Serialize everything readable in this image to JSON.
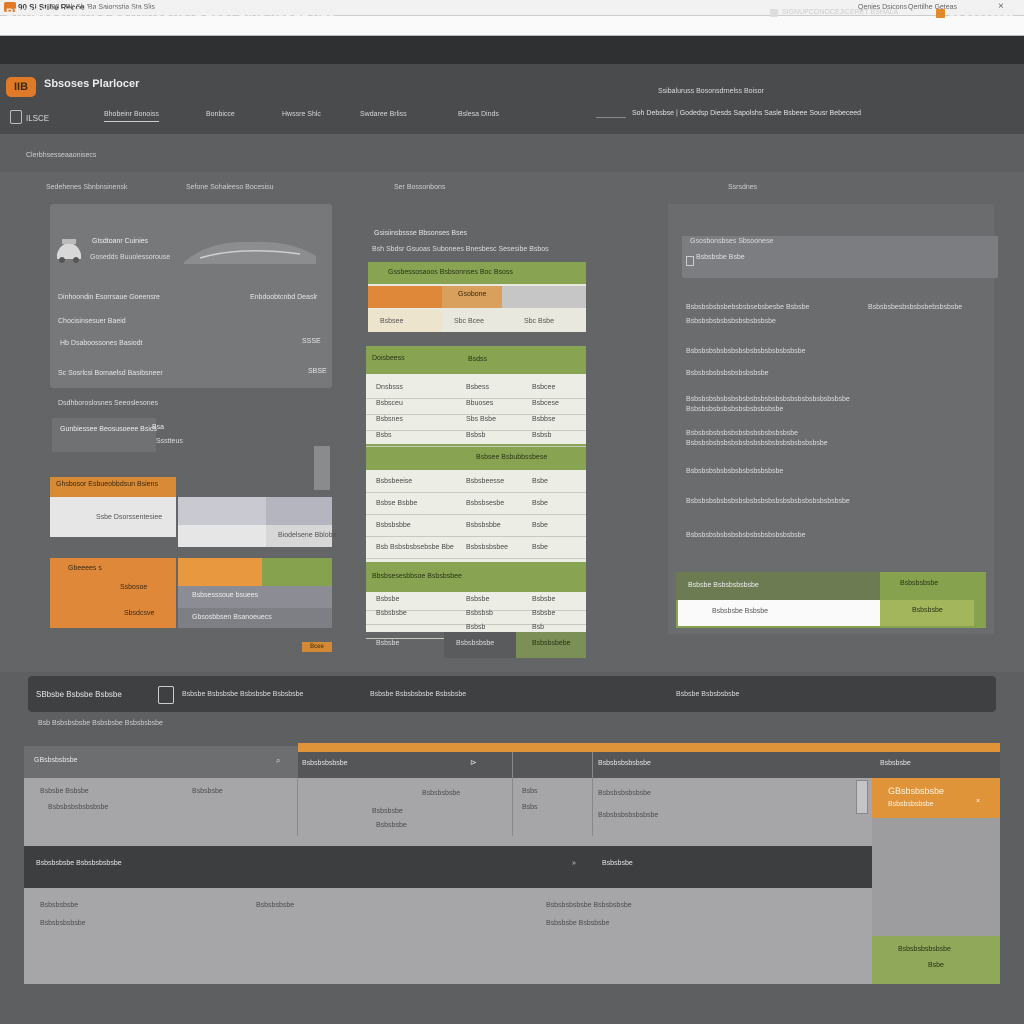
{
  "browser": {
    "tab_title": "90 Si Stibe Recce",
    "tab_url": "Q3 · Rk Sh 'Ba  Saiorsstia Sta Slis",
    "right_1": "Qenies Dsicons",
    "right_2": "Qertilhe Geteas",
    "close": "×"
  },
  "header": {
    "app_title": "BWRESSCRIDRSC BSTRIRODRSTE ESST  BIRS'NSDEE RES",
    "right_text": "SIGNUPCONOCEJICERET BSHALA",
    "user_label": "BS DSCOSSES"
  },
  "subheader": {
    "brand_logo": "IIB",
    "brand_name": "Sbsoses Plarlocer",
    "right_text": "Ssibaluruss Bosonsdrnelss Boisor",
    "back_label": "ILSCE",
    "tabs": [
      "Bhobeinr Bonoiss",
      "Bonbicce",
      "Hwssre Shlc",
      "Swdaree Brliss",
      "Bslesa Dinds"
    ],
    "status": "Soh Debsbse | Godedsp Diesds Sapolshs Sasle Bsbeee Sousr Bebeceed"
  },
  "page": {
    "title": "Clerbhsesseaaonisecs",
    "col_heads": [
      "Sedehenes Sbnbnsinensk",
      "Sefone Sohaleeso Bocesisu",
      "Ser Bossonbons",
      "Ssrsdnes"
    ]
  },
  "left_card": {
    "title": "Gtsdtoanr Cuinies",
    "subtitle": "Gosedds Buuolessorouse",
    "rows": [
      {
        "label": "Dinhoondin Esorrsaue Goeensre",
        "value": "Enbdoobtcnbd Deaslr"
      },
      {
        "label": "Chocisinsesuer Baeid"
      },
      {
        "label": "Hb Dsaboossones Basiodt",
        "value": "SSSE"
      },
      {
        "label": "Sc Sosrlcsi Bomaelsd Basibsneer",
        "value": "SBSE"
      }
    ],
    "note": "Dsdhboroslosnes Seeoslesones",
    "filter_label": "Gunbiessee Beosusoeee Bsics",
    "filter_x": "Bsa",
    "filter_sub": "Ssstteus",
    "orange_header": "Ghsbosor Esbueobbdsun Bsiens",
    "white_cell": "Ssbe Dsorssentesiee",
    "white_cell_2": "Biodelsene Bblobe",
    "orange_block": [
      "Gbeeees s",
      "Ssbosoe",
      "Sbsdcsve"
    ],
    "orange_extra_1": "Bsbsesssoue bsuees",
    "orange_extra_2": "Gbsosbbsen Bsanoeuecs",
    "tag": "Bcee"
  },
  "middle": {
    "title": "Gsisiinsbssse Bbsonses Bses",
    "subtitle": "Bsh Sbdsr Gsuoas Subonees Bnesbesc Sesesibe Bsbos",
    "plan_header": "Gssbessosaoos Bsbsonnses Boc Bsoss",
    "plan_bar_label": "Gsobone",
    "plan_row": [
      "Bsbsee",
      "Sbc Bcee",
      "Sbc Bsbe"
    ],
    "table_head_a": "Doisbeess",
    "table_head_b": "Bsdss",
    "table_rows_1": [
      [
        "Dnsbsss",
        "Bsbess",
        "Bsbcee"
      ],
      [
        "Bsbsceu",
        "Bbuoses",
        "Bsbcese"
      ],
      [
        "Bsbsnes",
        "Sbs Bsbe",
        "Bsbbse"
      ],
      [
        "Bsbs",
        "Bsbsb",
        "Bsbsb"
      ]
    ],
    "table_head_2": "Bsbsee Bsbubbssbese",
    "table_rows_2": [
      [
        "Bsbsbeeise",
        "Bsbsbeesse",
        "Bsbe"
      ],
      [
        "Bsbse Bsbbe",
        "Bsbsbsesbe",
        "Bsbe"
      ],
      [
        "Bsbsbsbbe",
        "Bsbsbsbbe",
        "Bsbe"
      ],
      [
        "Bsb Bsbsbsbsebsbe Bbe",
        "Bsbsbsbsbee",
        "Bsbe"
      ]
    ],
    "table_head_3": "Bbsbsesesbbsoe Bsbsbsbee",
    "table_rows_3": [
      [
        "Bsbsbe",
        "Bsbsbe",
        "Bsbsbe"
      ],
      [
        "Bsbsbsbe",
        "Bsbsbsb",
        "Bsbsbe"
      ],
      [
        "",
        "Bsbsb",
        "Bsb"
      ]
    ],
    "footer": [
      "Bsbsbe",
      "Bsbsbsbsbe",
      "Bsbsbsbebe"
    ]
  },
  "right": {
    "search_title": "Gsosbonsbses Sbsoonese",
    "search_text": "Bsbsbsbe Bsbe",
    "lines": [
      {
        "l": "Bsbsbsbsbsbebsbsbsebsbesbe Bsbsbe",
        "r": "Bsbsbsbesbsbsbsbebsbsbsbe"
      },
      {
        "l": "Bsbsbsbsbsbsbsbsbsbsbsbe"
      },
      {
        "l": "Bsbsbsbsbsbsbsbsbsbsbsbsbsbsbsbe"
      },
      {
        "l": "Bsbsbsbsbsbsbsbsbsbsbe"
      },
      {
        "l": "Bsbsbsbsbsbsbsbsbsbsbsbsbsbsbsbsbsbsbsbsbsbe"
      },
      {
        "l": "Bsbsbsbsbsbsbsbsbsbsbsbsbe"
      },
      {
        "l": "Bsbsbsbsbsbsbsbsbsbsbsbsbsbsbe"
      },
      {
        "l": "Bsbsbsbsbsbsbsbsbsbsbsbsbsbsbsbsbsbsbe"
      },
      {
        "l": "Bsbsbsbsbsbsbsbsbsbsbsbsbe"
      },
      {
        "l": "Bsbsbsbsbsbsbsbsbsbsbsbsbsbsbsbsbsbsbsbsbsbe"
      },
      {
        "l": "Bsbsbsbsbsbsbsbsbsbsbsbsbsbsbsbe"
      }
    ],
    "footer_label": "Bsbsbe Bsbsbsbsbsbe",
    "footer_tag": "Bsbsbsbsbe",
    "input_value": "Bsbsbsbe Bsbsbe",
    "button_label": "Bsbsbsbe"
  },
  "bottom": {
    "bar_1": "SBbsbe Bsbsbe Bsbsbe",
    "bar_2": "Bsbsbe Bsbsbsbe Bsbsbsbe Bsbsbsbe",
    "bar_3": "Bsbsbe Bsbsbsbsbe Bsbsbsbe",
    "bar_4": "Bsbsbe Bsbsbsbsbe",
    "crumb": "Bsb Bsbsbsbsbe Bsbsbsbe Bsbsbsbsbe",
    "grid_head_0": "GBsbsbsbsbe",
    "grid_head_0_icon": "⌕",
    "grid_head_1": "Bsbsbsbsbsbe",
    "grid_head_1_icon": "⊳",
    "grid_head_2": "Bsbsbsbsbsbsbe",
    "grid_head_3": "Bsbsbsbe",
    "cells": [
      "Bsbsbe Bsbsbe",
      "Bsbsbsbe",
      "Bsbsbsbsbsbsbsbe",
      "Bsbsbsbsbe",
      "Bsbsbsbe",
      "Bsbsbsbe",
      "Bsbs",
      "Bsbs",
      "Bsbsbsbsbsbsbe",
      "Bsbsbsbsbsbsbsbe"
    ],
    "cta_title": "GBsbsbsbsbe",
    "cta_sub": "Bsbsbsbsbsbe",
    "cta_x": "×",
    "dark_row_1": "Bsbsbsbsbe Bsbsbsbsbsbe",
    "dark_row_2": "»",
    "dark_row_3": "Bsbsbsbe",
    "rows": [
      "Bsbsbsbsbe",
      "Bsbsbsbsbsbe",
      "Bsbsbsbsbe",
      "Bsbsbsbsbsbe Bsbsbsbsbe",
      "Bsbsbsbe Bsbsbsbe"
    ],
    "green_cta_1": "Bsbsbsbsbsbsbe",
    "green_cta_2": "Bsbe"
  },
  "colors": {
    "accent_orange": "#e0883a",
    "accent_green": "#88a452",
    "dark_header": "#2f3031"
  }
}
